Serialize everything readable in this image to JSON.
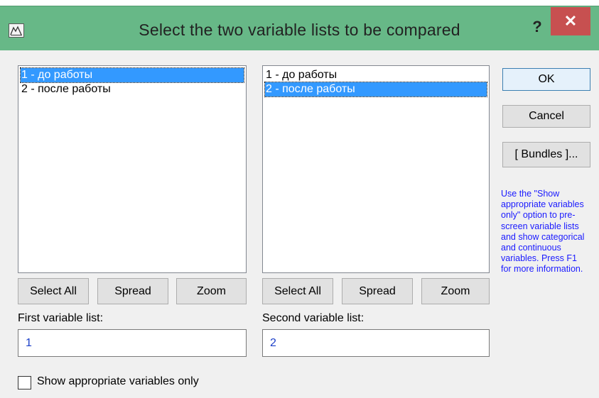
{
  "window": {
    "title": "Select the two variable lists to be compared",
    "help_label": "?",
    "close_label": "✕"
  },
  "first_list": {
    "items": [
      {
        "label": "1 - до работы",
        "selected": true
      },
      {
        "label": "2 - после работы",
        "selected": false
      }
    ],
    "select_all_label": "Select All",
    "spread_label": "Spread",
    "zoom_label": "Zoom",
    "field_label": "First variable list:",
    "field_value": "1"
  },
  "second_list": {
    "items": [
      {
        "label": "1 - до работы",
        "selected": false
      },
      {
        "label": "2 - после работы",
        "selected": true
      }
    ],
    "select_all_label": "Select All",
    "spread_label": "Spread",
    "zoom_label": "Zoom",
    "field_label": "Second variable list:",
    "field_value": "2"
  },
  "buttons": {
    "ok_label": "OK",
    "cancel_label": "Cancel",
    "bundles_label": "[ Bundles ]..."
  },
  "help_text": "Use the \"Show appropriate variables only\" option to pre-screen variable lists and show categorical and continuous variables. Press F1 for more information.",
  "checkbox": {
    "label": "Show appropriate variables only",
    "checked": false
  },
  "colors": {
    "titlebar": "#67b887",
    "close_button": "#c75050",
    "selection": "#3399ff",
    "help_text": "#1a1aff",
    "field_text": "#1a3ec8"
  }
}
